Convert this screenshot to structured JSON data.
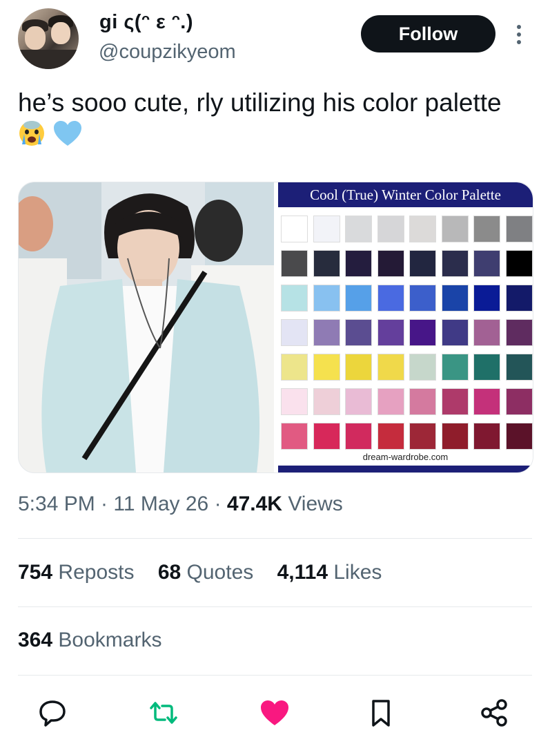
{
  "author": {
    "display_name": "gi ς(ᵔ ε ᵔ.)",
    "handle": "@coupzikyeom"
  },
  "follow_label": "Follow",
  "tweet": {
    "text": "he’s sooo cute, rly utilizing his color palette",
    "emojis": [
      "crying-face-emoji",
      "blue-heart-emoji"
    ]
  },
  "palette_image": {
    "title": "Cool (True) Winter Color Palette",
    "source": "dream-wardrobe.com",
    "swatches": [
      [
        "#ffffff",
        "#f2f3f8",
        "#d9dadc",
        "#d6d6d8",
        "#dcdad9",
        "#b8b8b9",
        "#8b8b8b",
        "#7f8083"
      ],
      [
        "#4a4a4c",
        "#272c3d",
        "#241d3e",
        "#241a36",
        "#222640",
        "#2b2d4c",
        "#3f3e70",
        "#000000"
      ],
      [
        "#b6e2e5",
        "#88c1f0",
        "#56a0e8",
        "#4a6ae1",
        "#3c5fcb",
        "#1a44a8",
        "#0a1b96",
        "#131a69"
      ],
      [
        "#e3e4f4",
        "#8f7bb4",
        "#5b4d91",
        "#643f9c",
        "#471688",
        "#403a86",
        "#a26194",
        "#5f2c60"
      ],
      [
        "#ede58b",
        "#f5e14e",
        "#ecd63c",
        "#f0d94a",
        "#c6d7cb",
        "#3a9584",
        "#1f7068",
        "#235558"
      ],
      [
        "#fae1ed",
        "#eecfd8",
        "#e9bbd5",
        "#e6a1c1",
        "#d47a9f",
        "#ae3a6a",
        "#c4317a",
        "#8d2e63"
      ],
      [
        "#e15a82",
        "#d7285a",
        "#d12a5e",
        "#c52c3d",
        "#9d2737",
        "#8f1d2b",
        "#7f1830",
        "#5b1229"
      ]
    ]
  },
  "timestamp": "5:34 PM · 11 May 26 · ",
  "views": {
    "count": "47.4K",
    "label": "Views"
  },
  "stats": {
    "reposts": {
      "count": "754",
      "label": "Reposts"
    },
    "quotes": {
      "count": "68",
      "label": "Quotes"
    },
    "likes": {
      "count": "4,114",
      "label": "Likes"
    },
    "bookmarks": {
      "count": "364",
      "label": "Bookmarks"
    }
  },
  "colors": {
    "text": "#0f1419",
    "secondary": "#536471",
    "repost_green": "#00ba7c",
    "like_pink": "#f91880",
    "divider": "#e6e9ec"
  },
  "actions": [
    "reply-icon",
    "repost-icon",
    "like-icon",
    "bookmark-icon",
    "share-icon"
  ]
}
